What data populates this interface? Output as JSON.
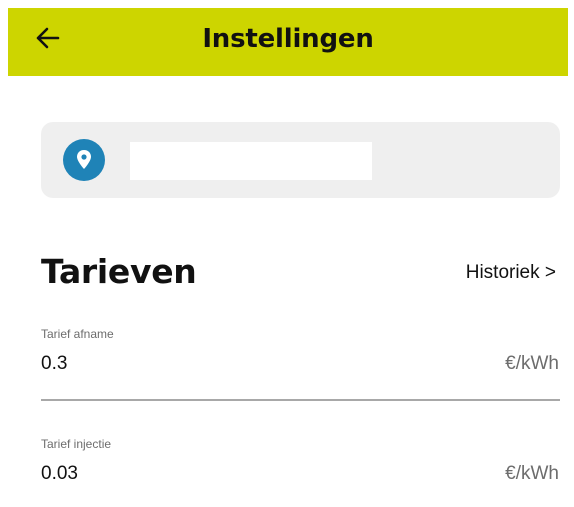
{
  "header": {
    "title": "Instellingen",
    "back_icon": "arrow-left-icon",
    "background_color": "#cdd500"
  },
  "location": {
    "icon": "map-pin-icon",
    "icon_color": "#1f83b7",
    "value": "",
    "placeholder": ""
  },
  "tarieven": {
    "title": "Tarieven",
    "history_label": "Historiek >",
    "fields": [
      {
        "label": "Tarief afname",
        "value": "0.3",
        "unit": "€/kWh"
      },
      {
        "label": "Tarief injectie",
        "value": "0.03",
        "unit": "€/kWh"
      }
    ]
  }
}
